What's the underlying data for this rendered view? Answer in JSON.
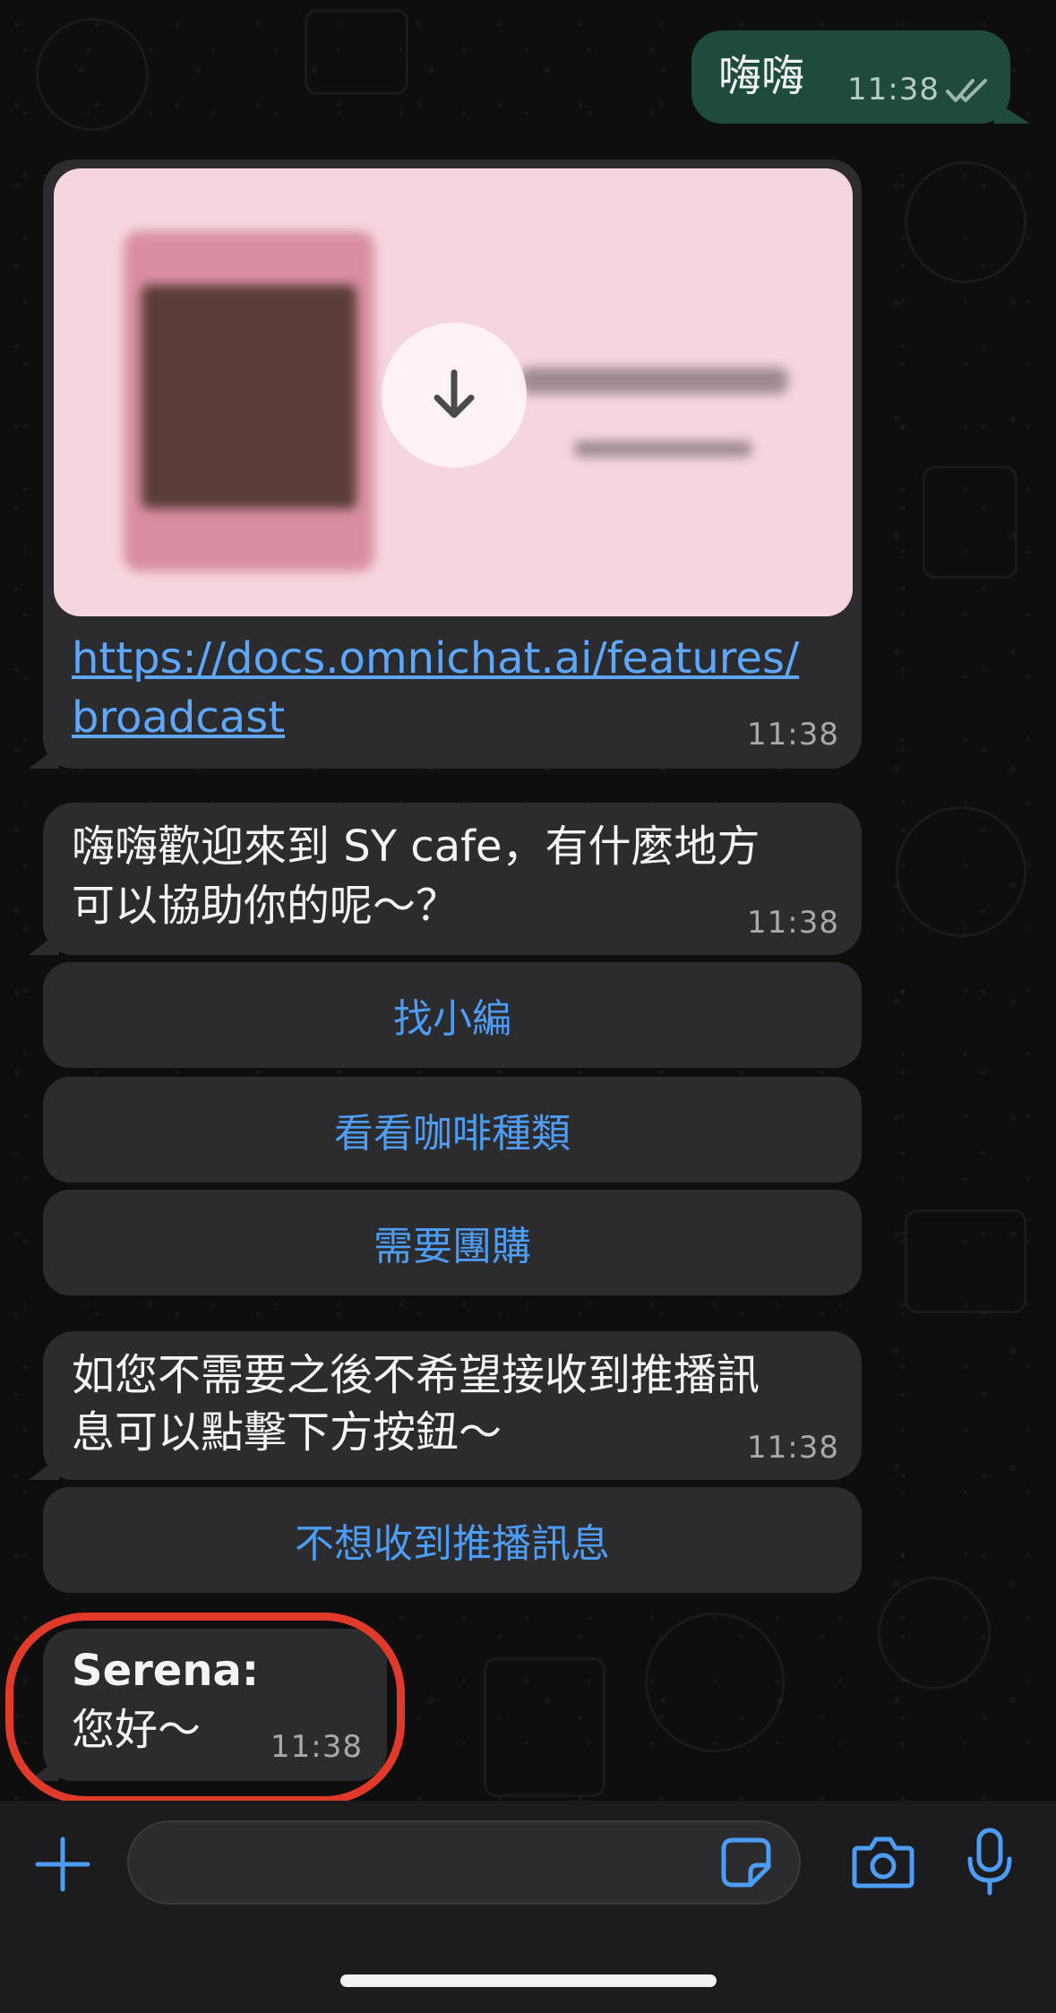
{
  "messages": {
    "outgoing": {
      "text": "嗨嗨",
      "time": "11:38"
    },
    "link_preview": {
      "url_line1": "https://docs.omnichat.ai/features/",
      "url_line2": "broadcast",
      "time": "11:38"
    },
    "welcome": {
      "line1": "嗨嗨歡迎來到 SY cafe，有什麼地方",
      "line2": "可以協助你的呢～？",
      "time": "11:38"
    },
    "quick_replies": [
      "找小編",
      "看看咖啡種類",
      "需要團購"
    ],
    "unsubscribe": {
      "line1": "如您不需要之後不希望接收到推播訊",
      "line2": "息可以點擊下方按鈕～",
      "time": "11:38"
    },
    "unsubscribe_button": "不想收到推播訊息",
    "agent": {
      "sender": "Serena:",
      "text": "您好～",
      "time": "11:38"
    }
  },
  "input_bar": {
    "add_icon": "plus-icon",
    "sticker_icon": "sticker-icon",
    "camera_icon": "camera-icon",
    "mic_icon": "microphone-icon"
  },
  "colors": {
    "accent": "#4d9cf5",
    "outgoing_bubble": "#1e4b3e",
    "incoming_bubble": "#2c2c2e",
    "highlight": "#e23a2a"
  }
}
